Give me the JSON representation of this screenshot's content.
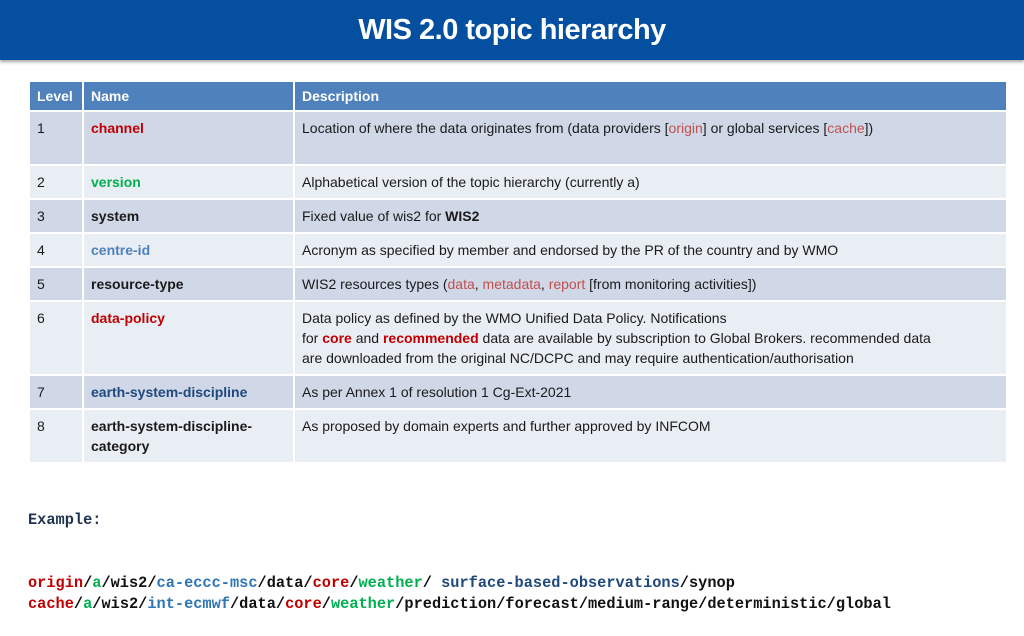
{
  "header": {
    "title": "WIS 2.0 topic hierarchy"
  },
  "colors": {
    "banner": "#054fa0",
    "table_header": "#4f81bd",
    "row_odd": "#d0d8e8",
    "row_even": "#e9edf4",
    "red": "#c00000",
    "green": "#00b050",
    "blue": "#4f81bd"
  },
  "table": {
    "columns": [
      "Level",
      "Name",
      "Description"
    ],
    "rows": [
      {
        "level": "1",
        "name": "channel",
        "name_color": "red",
        "description": [
          {
            "text": "Location of where the data originates from (data providers ["
          },
          {
            "text": "origin",
            "style": "brown"
          },
          {
            "text": "] or global services ["
          },
          {
            "text": "cache",
            "style": "brown"
          },
          {
            "text": "])"
          }
        ]
      },
      {
        "level": "2",
        "name": "version",
        "name_color": "green",
        "description": [
          {
            "text": "Alphabetical version of the topic hierarchy (currently a)"
          }
        ]
      },
      {
        "level": "3",
        "name": "system",
        "name_color": "black",
        "description": [
          {
            "text": "Fixed value of wis2 for "
          },
          {
            "text": "WIS2",
            "style": "bold"
          }
        ]
      },
      {
        "level": "4",
        "name": "centre-id",
        "name_color": "blue",
        "description": [
          {
            "text": "Acronym as specified by member and endorsed by the PR of the country and by WMO"
          }
        ]
      },
      {
        "level": "5",
        "name": "resource-type",
        "name_color": "black",
        "description": [
          {
            "text": "WIS2 resources types ("
          },
          {
            "text": "data",
            "style": "brown"
          },
          {
            "text": ", "
          },
          {
            "text": "metadata",
            "style": "brown"
          },
          {
            "text": ", "
          },
          {
            "text": "report",
            "style": "brown"
          },
          {
            "text": " [from monitoring activities])"
          }
        ]
      },
      {
        "level": "6",
        "name": "data-policy",
        "name_color": "red",
        "description": [
          {
            "text": "Data policy as defined by the WMO Unified Data Policy.  Notifications"
          },
          {
            "br": true
          },
          {
            "text": "for "
          },
          {
            "text": "core",
            "style": "red-bold"
          },
          {
            "text": " and "
          },
          {
            "text": "recommended",
            "style": "red-bold"
          },
          {
            "text": " data are available by subscription to Global Brokers. recommended data"
          },
          {
            "br": true
          },
          {
            "text": "are downloaded from the original NC/DCPC and may require authentication/authorisation"
          }
        ]
      },
      {
        "level": "7",
        "name": "earth-system-discipline",
        "name_color": "navy",
        "description": [
          {
            "text": "As per Annex 1 of resolution 1 Cg-Ext-2021"
          }
        ]
      },
      {
        "level": "8",
        "name": "earth-system-discipline-category",
        "name_color": "black",
        "description": [
          {
            "text": "As proposed by domain experts and further approved by INFCOM"
          }
        ]
      }
    ]
  },
  "example": {
    "title": "Example:",
    "lines": [
      [
        {
          "text": "origin",
          "color": "red"
        },
        {
          "text": "/",
          "color": "black"
        },
        {
          "text": "a",
          "color": "green"
        },
        {
          "text": "/wis2/",
          "color": "black"
        },
        {
          "text": "ca-eccc-msc",
          "color": "blue"
        },
        {
          "text": "/data/",
          "color": "black"
        },
        {
          "text": "core",
          "color": "red"
        },
        {
          "text": "/",
          "color": "black"
        },
        {
          "text": "weather",
          "color": "green"
        },
        {
          "text": "/ ",
          "color": "black"
        },
        {
          "text": "surface-based-observations",
          "color": "navy"
        },
        {
          "text": "/synop",
          "color": "black"
        }
      ],
      [
        {
          "text": "cache",
          "color": "red"
        },
        {
          "text": "/",
          "color": "black"
        },
        {
          "text": "a",
          "color": "green"
        },
        {
          "text": "/wis2/",
          "color": "black"
        },
        {
          "text": "int-ecmwf",
          "color": "blue"
        },
        {
          "text": "/data/",
          "color": "black"
        },
        {
          "text": "core",
          "color": "red"
        },
        {
          "text": "/",
          "color": "black"
        },
        {
          "text": "weather",
          "color": "green"
        },
        {
          "text": "/prediction/forecast/medium-range/deterministic/global",
          "color": "black"
        }
      ]
    ]
  }
}
